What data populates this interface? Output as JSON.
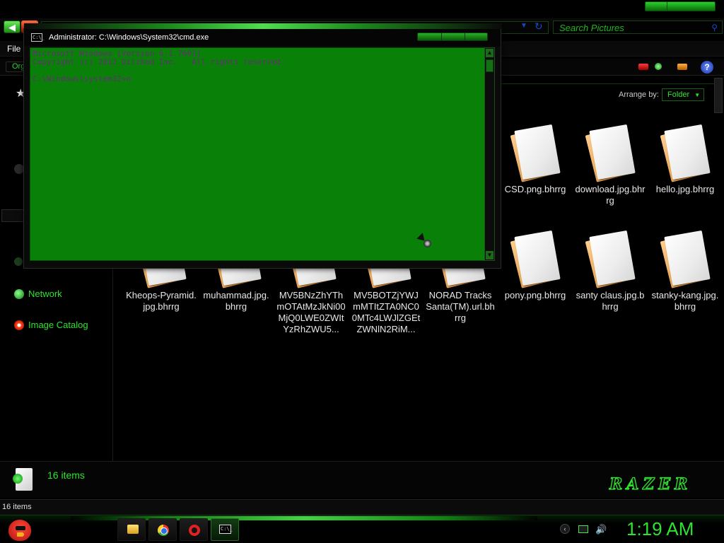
{
  "explorer": {
    "menu_label": "File",
    "organize_label": "Org",
    "search_placeholder": "Search Pictures",
    "arrange_label": "Arrange by:",
    "arrange_value": "Folder",
    "nav": [
      {
        "label": "Network"
      },
      {
        "label": "Image Catalog"
      }
    ],
    "files_top": [
      {
        "name": "CSD.png.bhrrg"
      },
      {
        "name": "download.jpg.bhrrg"
      },
      {
        "name": "hello.jpg.bhrrg"
      }
    ],
    "files_bottom": [
      {
        "name": "Kheops-Pyramid.jpg.bhrrg"
      },
      {
        "name": "muhammad.jpg.bhrrg"
      },
      {
        "name": "MV5BNzZhYThmOTAtMzJkNi00MjQ0LWE0ZWItYzRhZWU5..."
      },
      {
        "name": "MV5BOTZjYWJmMTItZTA0NC00MTc4LWJlZGEtZWNlN2RiM..."
      },
      {
        "name": "NORAD Tracks Santa(TM).url.bhrrg"
      },
      {
        "name": "pony.png.bhrrg"
      },
      {
        "name": "santy claus.jpg.bhrrg"
      },
      {
        "name": "stanky-kang.jpg.bhrrg"
      }
    ],
    "item_count": "16 items",
    "status_text": "16 items",
    "brand": "RAZER"
  },
  "cmd": {
    "title": "Administrator: C:\\Windows\\System32\\cmd.exe",
    "icon_text": "C:\\_",
    "lines": "Microsoft Windows [Version 6.1.7601]\nCopyright (c) 2012 Dilzhad Inc.   All rights reserved.\n\nC:\\Windows\\system32>n"
  },
  "taskbar": {
    "clock": "1:19 AM",
    "cmd_icon_text": "C:\\_"
  },
  "colors": {
    "accent": "#2ee32e",
    "console_bg": "#098109",
    "console_text": "#6b2a7a"
  }
}
